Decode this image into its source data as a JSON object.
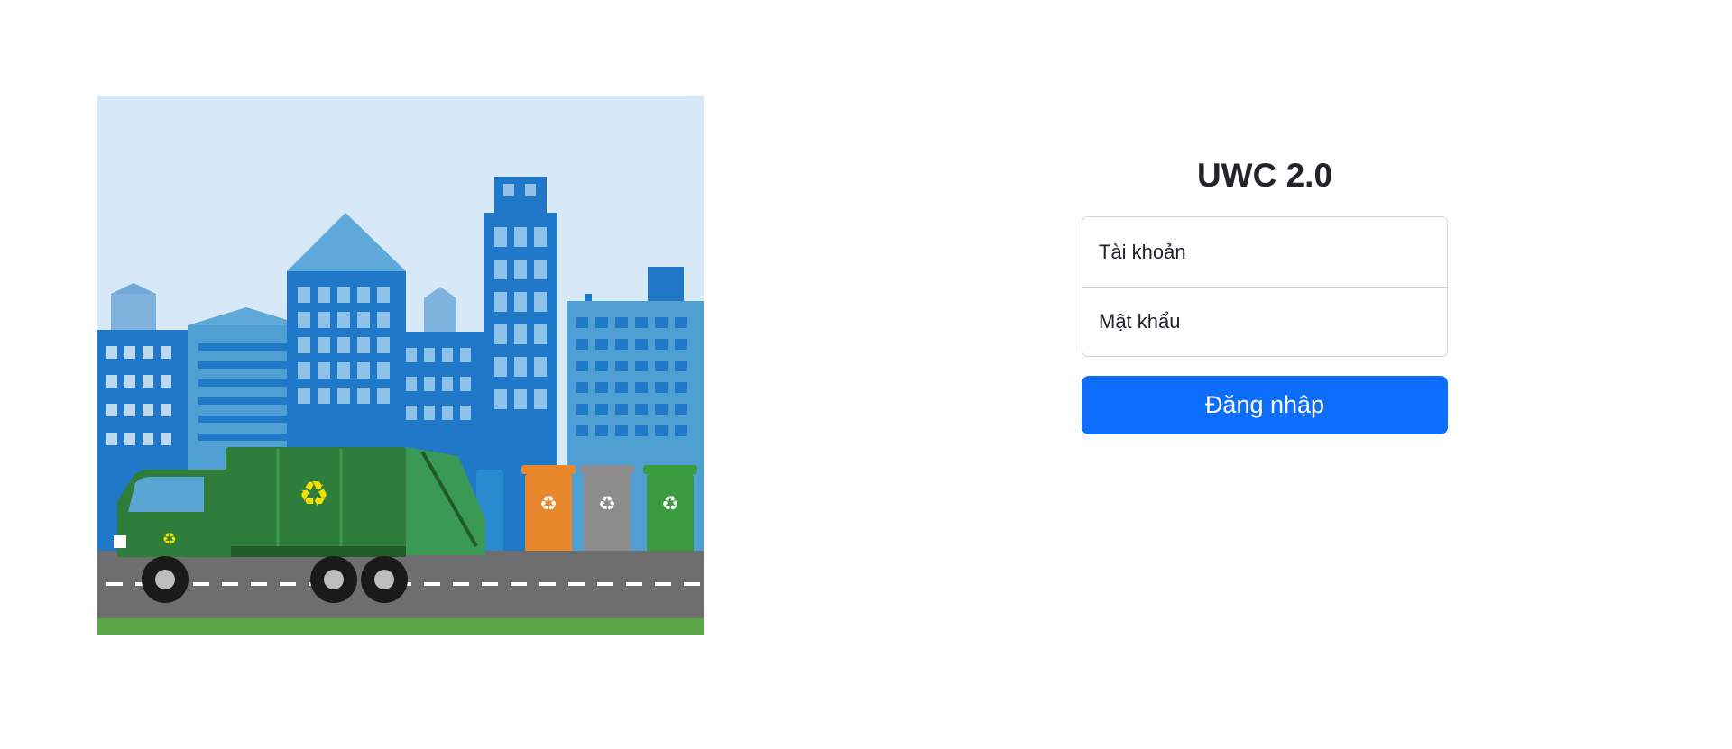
{
  "login": {
    "title": "UWC 2.0",
    "username_placeholder": "Tài khoản",
    "password_placeholder": "Mật khẩu",
    "submit_label": "Đăng nhập"
  },
  "colors": {
    "primary": "#0d6efd",
    "sky": "#d7e9f6",
    "truck": "#2e7d3b",
    "road": "#6e6e6e",
    "grass": "#5aa545"
  },
  "illustration": {
    "recycle_symbol": "♻",
    "subject": "garbage-truck-city-illustration"
  }
}
